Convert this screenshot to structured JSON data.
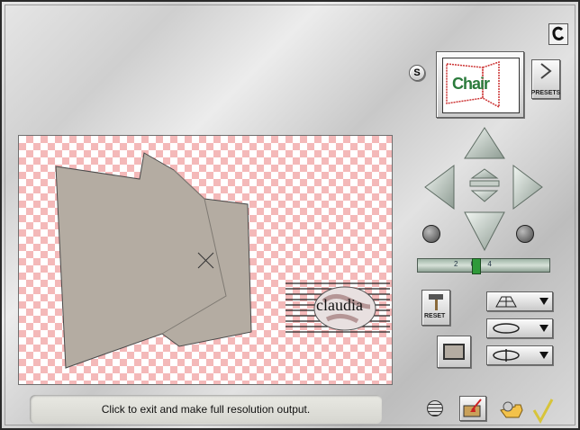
{
  "status": {
    "message": "Click to exit and make full resolution output."
  },
  "preset": {
    "thumbnail_text": "Chair",
    "button_label": "PRESETS"
  },
  "reset": {
    "label": "RESET"
  },
  "s_button": {
    "label": "S"
  },
  "slider": {
    "ticks": "2  0  4"
  },
  "logo": {
    "text": "claudia"
  },
  "colors": {
    "checker": "#f4b9b9",
    "shape": "#b4aca2",
    "panel": "#d7d7d7",
    "arrow": "#a9b6ad"
  },
  "icons": {
    "corner": "c-logo-icon",
    "nav": [
      "up-arrow-icon",
      "left-arrow-icon",
      "right-arrow-icon",
      "down-arrow-icon",
      "center-up-icon",
      "center-down-icon"
    ],
    "knobs": [
      "rotate-left-knob-icon",
      "rotate-right-knob-icon"
    ],
    "dropdowns": [
      "grid-plane-icon",
      "rotate-horizontal-icon",
      "rotate-axis-icon"
    ],
    "bottom": [
      "grid-icon",
      "export-icon",
      "hand-pointer-icon",
      "checkmark-icon"
    ]
  }
}
